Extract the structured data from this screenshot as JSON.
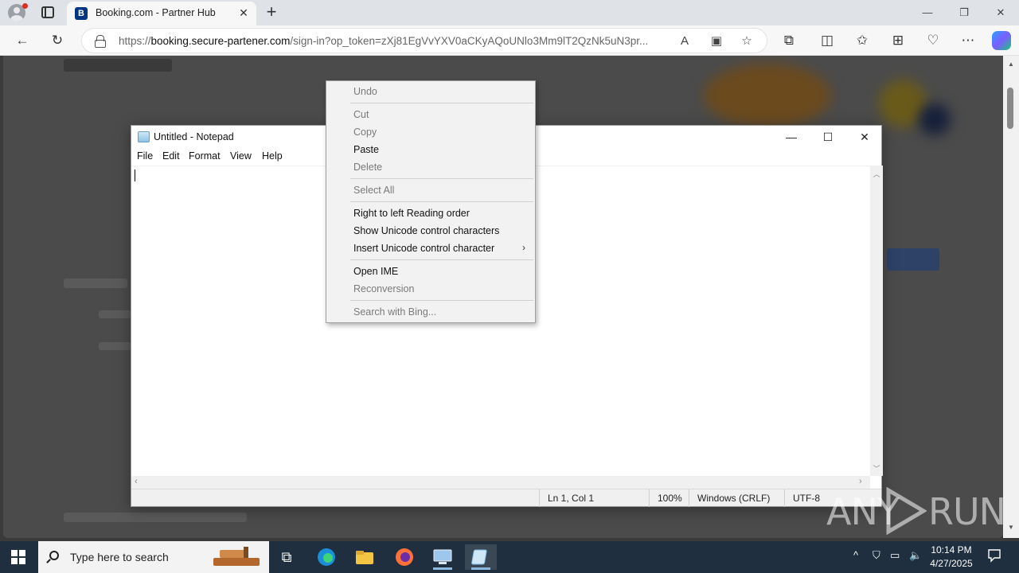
{
  "browser": {
    "tab_title": "Booking.com - Partner Hub",
    "tab_favicon_letter": "B",
    "url_prefix": "https://",
    "url_host": "booking.secure-partener.com",
    "url_path": "/sign-in?op_token=zXj81EgVvYXV0aCKyAQoUNlo3Mm9lT2QzNk5uN3pr...",
    "icons": [
      "back-icon",
      "refresh-icon",
      "lock-icon",
      "read-aloud-icon",
      "immersive-reader-icon",
      "favorite-star-icon",
      "extensions-icon",
      "split-screen-icon",
      "favorites-icon",
      "collections-icon",
      "browser-essentials-icon",
      "more-icon",
      "copilot-icon"
    ]
  },
  "notepad": {
    "title": "Untitled - Notepad",
    "menu": [
      "File",
      "Edit",
      "Format",
      "View",
      "Help"
    ],
    "content": "",
    "status": {
      "position": "Ln 1, Col 1",
      "zoom": "100%",
      "line_ending": "Windows (CRLF)",
      "encoding": "UTF-8"
    }
  },
  "context_menu": {
    "items": [
      {
        "label": "Undo",
        "enabled": false
      },
      {
        "label": "Cut",
        "enabled": false
      },
      {
        "label": "Copy",
        "enabled": false
      },
      {
        "label": "Paste",
        "enabled": true
      },
      {
        "label": "Delete",
        "enabled": false
      },
      {
        "label": "Select All",
        "enabled": false
      },
      {
        "label": "Right to left Reading order",
        "enabled": true
      },
      {
        "label": "Show Unicode control characters",
        "enabled": true
      },
      {
        "label": "Insert Unicode control character",
        "enabled": true,
        "submenu": true
      },
      {
        "label": "Open IME",
        "enabled": true
      },
      {
        "label": "Reconversion",
        "enabled": false
      },
      {
        "label": "Search with Bing...",
        "enabled": false
      }
    ]
  },
  "watermark": {
    "text_left": "ANY",
    "text_right": "RUN"
  },
  "taskbar": {
    "search_placeholder": "Type here to search",
    "clock_time": "10:14 PM",
    "clock_date": "4/27/2025",
    "apps": [
      "task-view-icon",
      "edge-icon",
      "file-explorer-icon",
      "firefox-icon",
      "network-app-icon",
      "notepad-icon"
    ]
  },
  "colors": {
    "taskbar": "#1f2f3f",
    "page_dim": "#4b4b4b",
    "booking_blue": "#003580"
  }
}
